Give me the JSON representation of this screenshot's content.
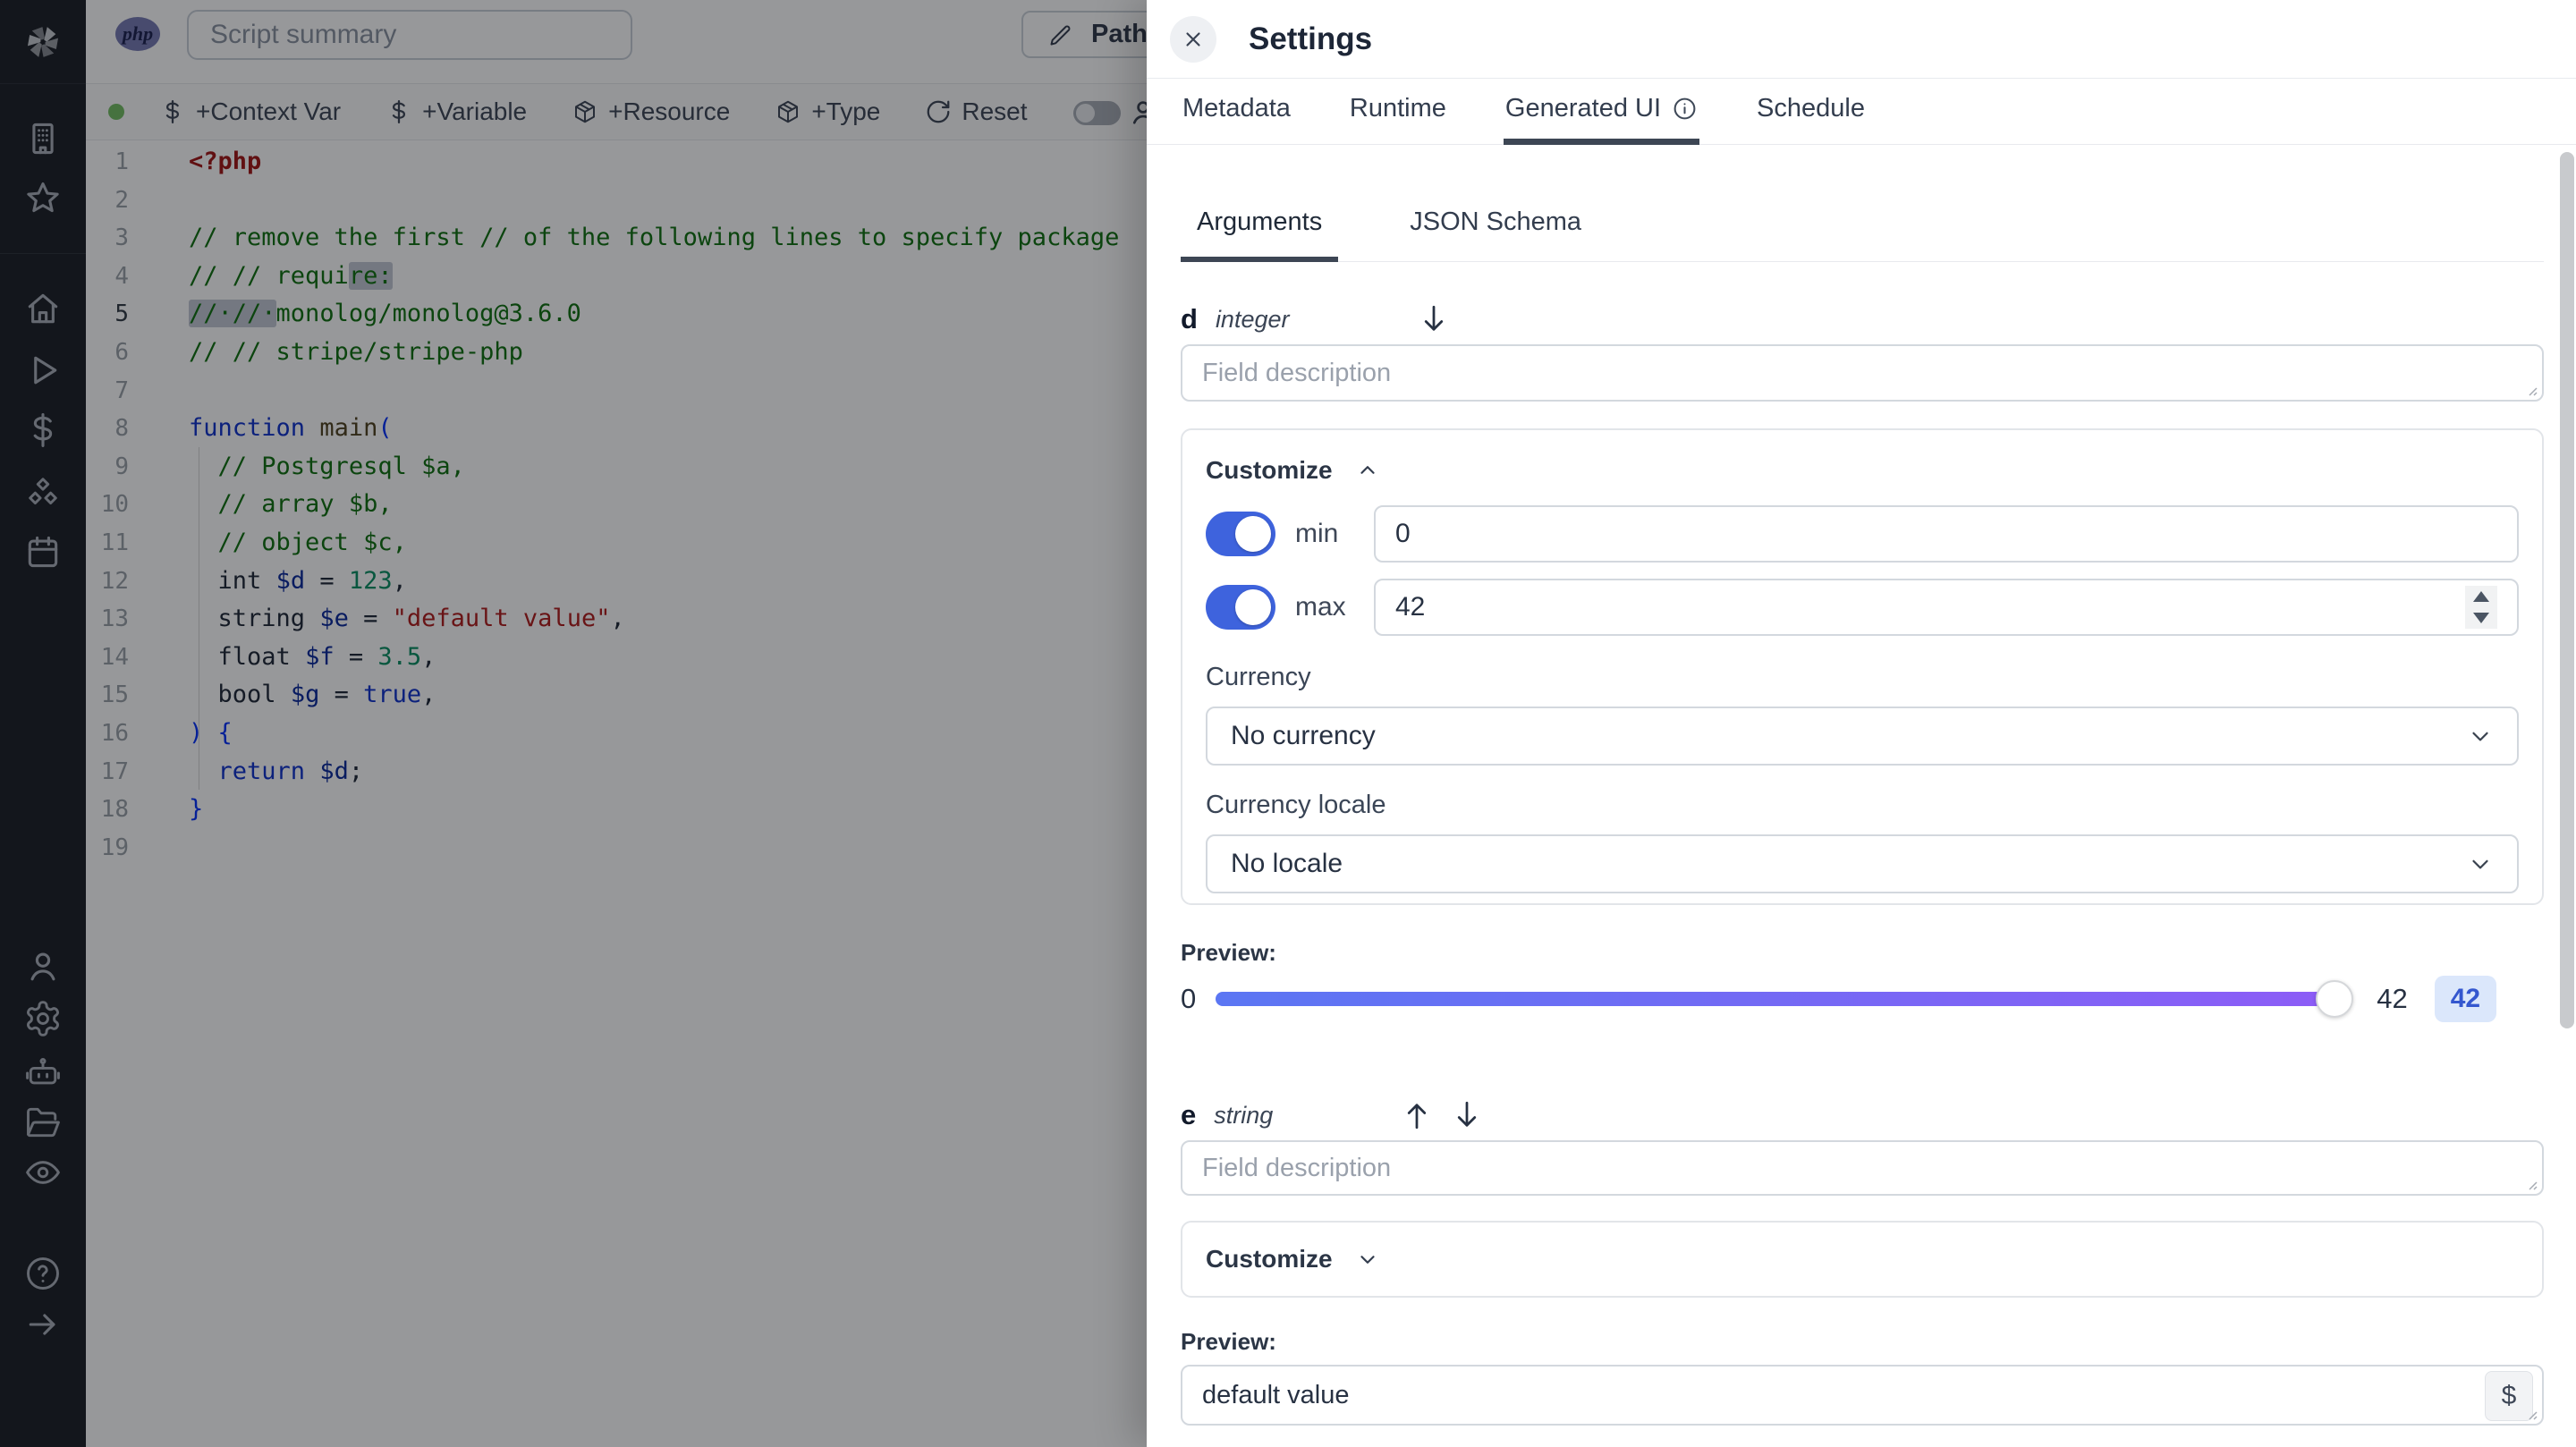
{
  "sidebar": {
    "icons": [
      "windmill-logo",
      "building",
      "star",
      "home",
      "play",
      "dollar",
      "boxes",
      "calendar",
      "user",
      "settings",
      "bot",
      "folder-open",
      "eye",
      "help",
      "arrow-right"
    ]
  },
  "header": {
    "language_badge": "php",
    "script_summary_placeholder": "Script summary",
    "path_button_label": "Path"
  },
  "toolbar": {
    "context_var": "+Context Var",
    "variable": "+Variable",
    "resource": "+Resource",
    "type": "+Type",
    "reset": "Reset"
  },
  "editor": {
    "active_line": "5",
    "lines": [
      {
        "n": "1",
        "seg": [
          [
            "tag",
            "<?php"
          ]
        ]
      },
      {
        "n": "2",
        "seg": []
      },
      {
        "n": "3",
        "seg": [
          [
            "cmt",
            "// remove the first // of the following lines to specify package"
          ]
        ]
      },
      {
        "n": "4",
        "seg": [
          [
            "cmt",
            "// // requi"
          ],
          [
            "cmt hl",
            "re:"
          ]
        ]
      },
      {
        "n": "5",
        "active": true,
        "seg": [
          [
            "cmt hl",
            "//·//·"
          ],
          [
            "cmt",
            "monolog/monolog@3.6.0"
          ]
        ]
      },
      {
        "n": "6",
        "seg": [
          [
            "cmt",
            "// // stripe/stripe-php"
          ]
        ]
      },
      {
        "n": "7",
        "seg": []
      },
      {
        "n": "8",
        "seg": [
          [
            "kw",
            "function "
          ],
          [
            "fn",
            "main"
          ],
          [
            "brkt",
            "("
          ]
        ]
      },
      {
        "n": "9",
        "seg": [
          [
            "pln",
            "  "
          ],
          [
            "cmt",
            "// Postgresql $a,"
          ]
        ]
      },
      {
        "n": "10",
        "seg": [
          [
            "pln",
            "  "
          ],
          [
            "cmt",
            "// array $b,"
          ]
        ]
      },
      {
        "n": "11",
        "seg": [
          [
            "pln",
            "  "
          ],
          [
            "cmt",
            "// object $c,"
          ]
        ]
      },
      {
        "n": "12",
        "seg": [
          [
            "pln",
            "  "
          ],
          [
            "typ",
            "int"
          ],
          [
            "pln",
            " "
          ],
          [
            "var",
            "$d"
          ],
          [
            "pln",
            " = "
          ],
          [
            "num",
            "123"
          ],
          [
            "pln",
            ","
          ]
        ]
      },
      {
        "n": "13",
        "seg": [
          [
            "pln",
            "  "
          ],
          [
            "typ",
            "string"
          ],
          [
            "pln",
            " "
          ],
          [
            "var",
            "$e"
          ],
          [
            "pln",
            " = "
          ],
          [
            "str",
            "\"default value\""
          ],
          [
            "pln",
            ","
          ]
        ]
      },
      {
        "n": "14",
        "seg": [
          [
            "pln",
            "  "
          ],
          [
            "typ",
            "float"
          ],
          [
            "pln",
            " "
          ],
          [
            "var",
            "$f"
          ],
          [
            "pln",
            " = "
          ],
          [
            "num",
            "3.5"
          ],
          [
            "pln",
            ","
          ]
        ]
      },
      {
        "n": "15",
        "seg": [
          [
            "pln",
            "  "
          ],
          [
            "typ",
            "bool"
          ],
          [
            "pln",
            " "
          ],
          [
            "var",
            "$g"
          ],
          [
            "pln",
            " = "
          ],
          [
            "kw",
            "true"
          ],
          [
            "pln",
            ","
          ]
        ]
      },
      {
        "n": "16",
        "seg": [
          [
            "brkt",
            ") {"
          ]
        ]
      },
      {
        "n": "17",
        "seg": [
          [
            "pln",
            "  "
          ],
          [
            "kw",
            "return "
          ],
          [
            "var",
            "$d"
          ],
          [
            "pln",
            ";"
          ]
        ]
      },
      {
        "n": "18",
        "seg": [
          [
            "brkt",
            "}"
          ]
        ]
      },
      {
        "n": "19",
        "seg": []
      }
    ]
  },
  "settings": {
    "title": "Settings",
    "tabs": [
      {
        "label": "Metadata"
      },
      {
        "label": "Runtime"
      },
      {
        "label": "Generated UI",
        "active": true,
        "info_icon": true
      },
      {
        "label": "Schedule"
      }
    ],
    "subtabs": [
      {
        "label": "Arguments",
        "active": true
      },
      {
        "label": "JSON Schema"
      }
    ],
    "field_d": {
      "name": "d",
      "type": "integer",
      "description_placeholder": "Field description",
      "customize_label": "Customize",
      "min_label": "min",
      "min_value": "0",
      "max_label": "max",
      "max_value": "42",
      "currency_label": "Currency",
      "currency_value": "No currency",
      "currency_locale_label": "Currency locale",
      "currency_locale_value": "No locale",
      "preview_label": "Preview:",
      "slider_min": "0",
      "slider_max": "42",
      "slider_value": "42"
    },
    "field_e": {
      "name": "e",
      "type": "string",
      "description_placeholder": "Field description",
      "customize_label": "Customize",
      "preview_label": "Preview:",
      "preview_value": "default value",
      "dollar_button": "$"
    }
  }
}
